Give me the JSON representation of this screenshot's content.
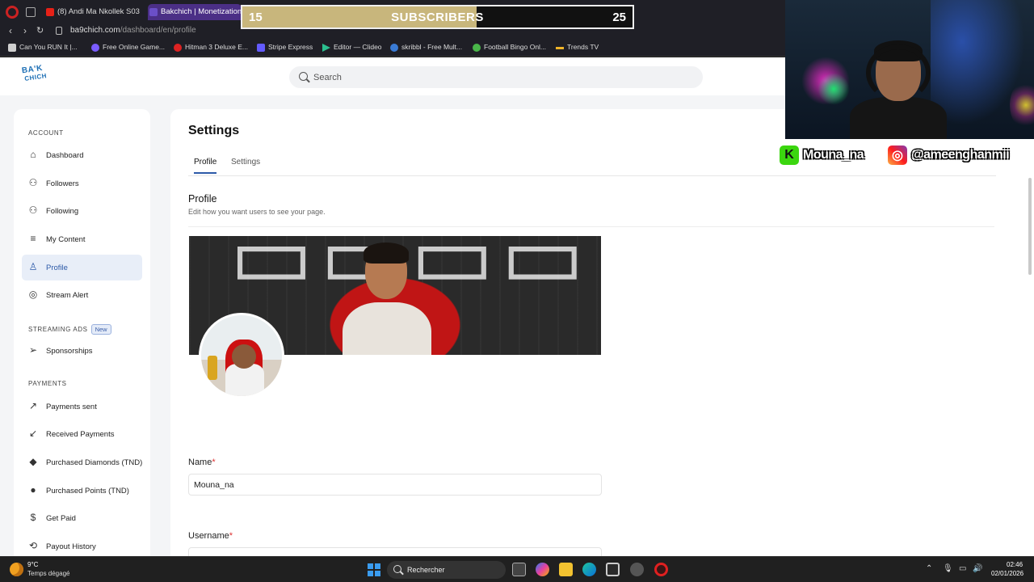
{
  "browser": {
    "tabs": [
      {
        "label": "(8) Andi Ma Nkollek S03-",
        "active": false,
        "favicon_color": "#e62117"
      },
      {
        "label": "Bakchich | Monetization fo",
        "active": true,
        "favicon_color": "#6b4fc8"
      }
    ],
    "url_host": "ba9chich.com",
    "url_path": "/dashboard/en/profile",
    "bookmarks": [
      {
        "label": "Can You RUN It |...",
        "color": "#cfcfcf"
      },
      {
        "label": "Free Online Game...",
        "color": "#7a5cff"
      },
      {
        "label": "Hitman 3 Deluxe E...",
        "color": "#d22"
      },
      {
        "label": "Stripe Express",
        "color": "#635bff"
      },
      {
        "label": "Editor — Clideo",
        "color": "#2bbf8e"
      },
      {
        "label": "skribbl - Free Mult...",
        "color": "#3a7bd5"
      },
      {
        "label": "Football Bingo Onl...",
        "color": "#49b649"
      },
      {
        "label": "Trends TV",
        "color": "#f0b429"
      }
    ]
  },
  "overlay": {
    "sub_start": "15",
    "sub_label": "SUBSCRIBERS",
    "sub_goal": "25",
    "sub_progress": 0.6,
    "kick_handle": "Mouna_na",
    "instagram_handle": "@ameenghanmii"
  },
  "header": {
    "logo_line1": "BA'K",
    "logo_line2": "CHICH",
    "search_placeholder": "Search"
  },
  "sidebar": {
    "sections": [
      {
        "title": "ACCOUNT",
        "badge": ""
      },
      {
        "title": "STREAMING ADS",
        "badge": "New"
      },
      {
        "title": "PAYMENTS",
        "badge": ""
      }
    ],
    "items": [
      {
        "label": "Dashboard",
        "icon": "home-icon",
        "active": false
      },
      {
        "label": "Followers",
        "icon": "users-icon",
        "active": false
      },
      {
        "label": "Following",
        "icon": "users-icon",
        "active": false
      },
      {
        "label": "My Content",
        "icon": "list-icon",
        "active": false
      },
      {
        "label": "Profile",
        "icon": "user-icon",
        "active": true
      },
      {
        "label": "Stream Alert",
        "icon": "target-icon",
        "active": false
      },
      {
        "label": "Sponsorships",
        "icon": "send-icon",
        "active": false
      },
      {
        "label": "Payments sent",
        "icon": "arrow-up-right-icon",
        "active": false
      },
      {
        "label": "Received Payments",
        "icon": "arrow-down-left-icon",
        "active": false
      },
      {
        "label": "Purchased Diamonds (TND)",
        "icon": "diamond-icon",
        "active": false
      },
      {
        "label": "Purchased Points (TND)",
        "icon": "coin-icon",
        "active": false
      },
      {
        "label": "Get Paid",
        "icon": "dollar-icon",
        "active": false
      },
      {
        "label": "Payout History",
        "icon": "history-icon",
        "active": false
      }
    ]
  },
  "main": {
    "title": "Settings",
    "tabs": [
      {
        "label": "Profile",
        "active": true
      },
      {
        "label": "Settings",
        "active": false
      }
    ],
    "section_title": "Profile",
    "section_subtitle": "Edit how you want users to see your page.",
    "fields": [
      {
        "label": "Name",
        "required_mark": "*",
        "value": "Mouna_na"
      },
      {
        "label": "Username",
        "required_mark": "*",
        "value": ""
      }
    ]
  },
  "taskbar": {
    "weather_temp": "9°C",
    "weather_desc": "Temps dégagé",
    "search_label": "Rechercher",
    "time": "02:46",
    "date": "02/01/2026"
  }
}
